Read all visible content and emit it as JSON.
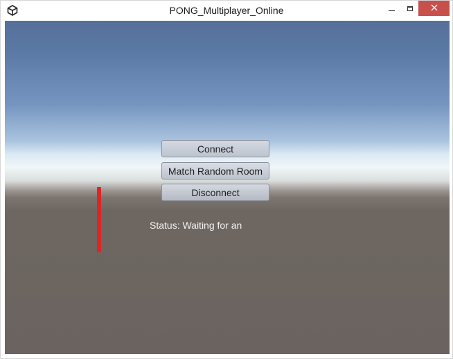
{
  "window": {
    "title": "PONG_Multiplayer_Online",
    "icon": "unity-logo-icon",
    "controls": [
      "minimize",
      "maximize",
      "close"
    ]
  },
  "menu": {
    "connect_label": "Connect",
    "match_random_label": "Match Random Room",
    "disconnect_label": "Disconnect"
  },
  "status": {
    "text": "Status: Waiting for an"
  },
  "colors": {
    "paddle": "#e02424",
    "close_button": "#c7504c"
  }
}
